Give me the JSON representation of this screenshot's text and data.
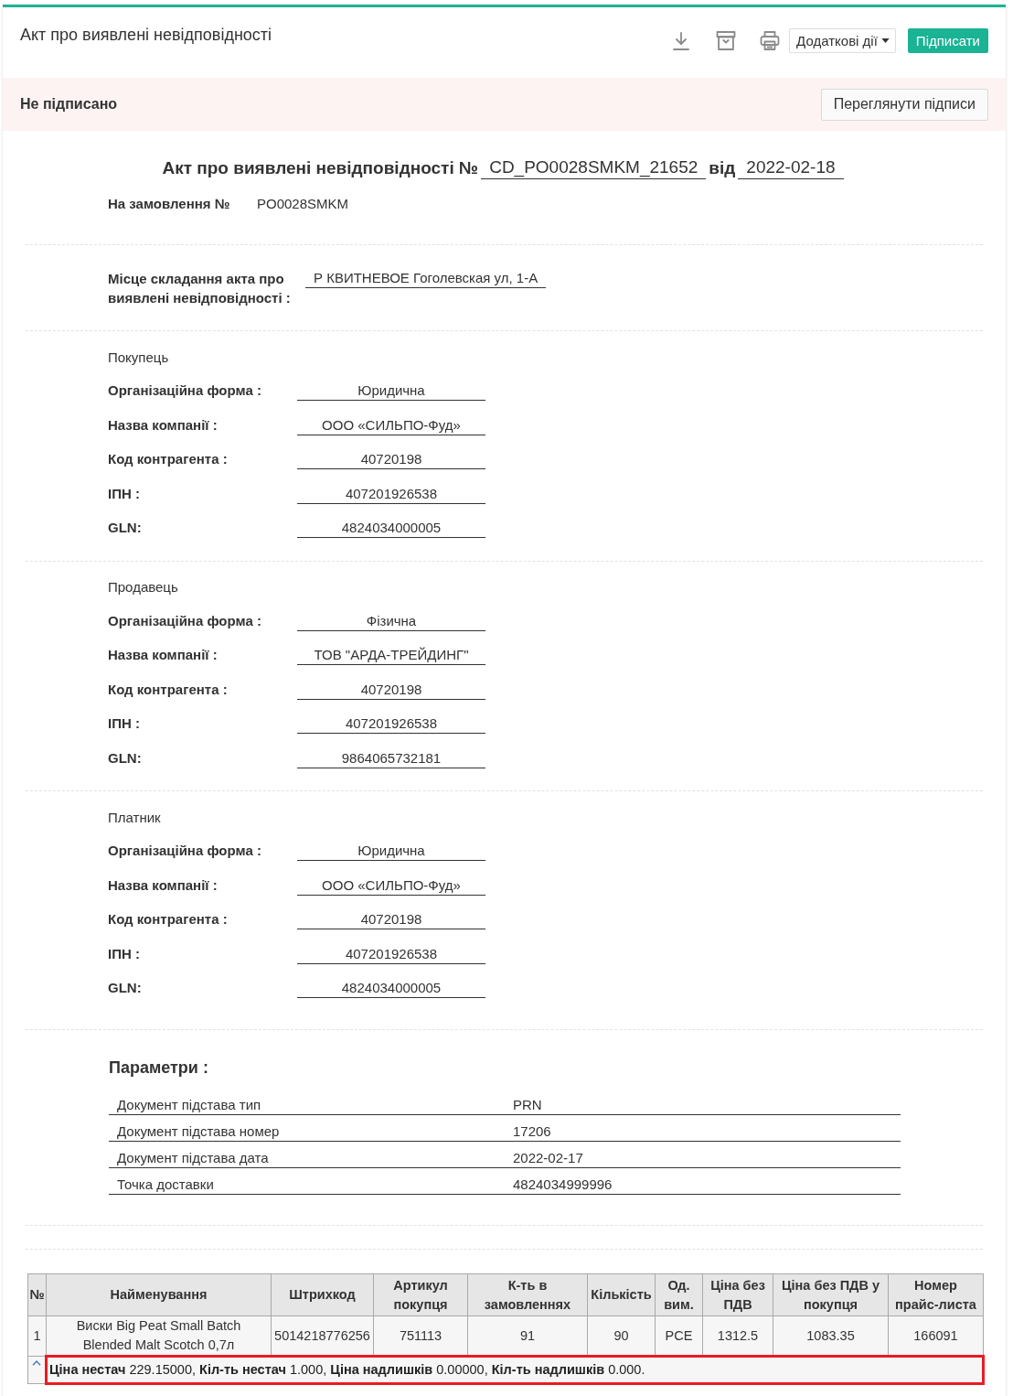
{
  "header": {
    "title": "Акт про виявлені невідповідності",
    "more_actions": "Додаткові дії",
    "sign_button": "Підписати"
  },
  "status_bar": {
    "status": "Не підписано",
    "signed": false,
    "view_button": "Переглянути підписи"
  },
  "document": {
    "title": "Акт про виявлені невідповідності №",
    "number": "CD_PO0028SMKM_21652",
    "date_label": "від",
    "date": "2022-02-18",
    "order_label": "На замовлення №",
    "order_number": "PO0028SMKM",
    "place_label": "Місце складання акта про виявлені невідповідності :",
    "place": "Р КВИТНЕВОЕ Гоголевская ул, 1-А"
  },
  "parties": [
    {
      "title": "Покупець",
      "fields": [
        {
          "label": "Організаційна форма :",
          "value": "Юридична"
        },
        {
          "label": "Назва компанії :",
          "value": "ООО «СИЛЬПО-Фуд»"
        },
        {
          "label": "Код контрагента :",
          "value": "40720198"
        },
        {
          "label": "ІПН :",
          "value": "407201926538"
        },
        {
          "label": "GLN:",
          "value": "4824034000005"
        }
      ]
    },
    {
      "title": "Продавець",
      "fields": [
        {
          "label": "Організаційна форма :",
          "value": "Фізична"
        },
        {
          "label": "Назва компанії :",
          "value": "ТОВ \"АРДА-ТРЕЙДИНГ\""
        },
        {
          "label": "Код контрагента :",
          "value": "40720198"
        },
        {
          "label": "ІПН :",
          "value": "407201926538"
        },
        {
          "label": "GLN:",
          "value": "9864065732181"
        }
      ]
    },
    {
      "title": "Платник",
      "fields": [
        {
          "label": "Організаційна форма :",
          "value": "Юридична"
        },
        {
          "label": "Назва компанії :",
          "value": "ООО «СИЛЬПО-Фуд»"
        },
        {
          "label": "Код контрагента :",
          "value": "40720198"
        },
        {
          "label": "ІПН :",
          "value": "407201926538"
        },
        {
          "label": "GLN:",
          "value": "4824034000005"
        }
      ]
    }
  ],
  "parameters": {
    "title": "Параметри :",
    "rows": [
      {
        "name": "Документ підстава тип",
        "value": "PRN"
      },
      {
        "name": "Документ підстава номер",
        "value": "17206"
      },
      {
        "name": "Документ підстава дата",
        "value": "2022-02-17"
      },
      {
        "name": "Точка доставки",
        "value": "4824034999996"
      }
    ]
  },
  "table": {
    "columns": [
      "№",
      "Найменування",
      "Штрихкод",
      "Артикул покупця",
      "К-ть в замовленнях",
      "Кількість",
      "Од. вим.",
      "Ціна без ПДВ",
      "Ціна без ПДВ у покупця",
      "Номер прайс-листа"
    ],
    "rows": [
      {
        "cells": [
          "1",
          "Виски Big Peat Small Batch Blended Malt Scotch 0,7л",
          "5014218776256",
          "751113",
          "91",
          "90",
          "PCE",
          "1312.5",
          "1083.35",
          "166091"
        ],
        "expanded": true,
        "highlighted": true,
        "summary": "**Ціна нестач** 229.15000, **Кіл-ть нестач** 1.000, **Ціна надлишків** 0.00000, **Кіл-ть надлишків** 0.000."
      }
    ]
  }
}
